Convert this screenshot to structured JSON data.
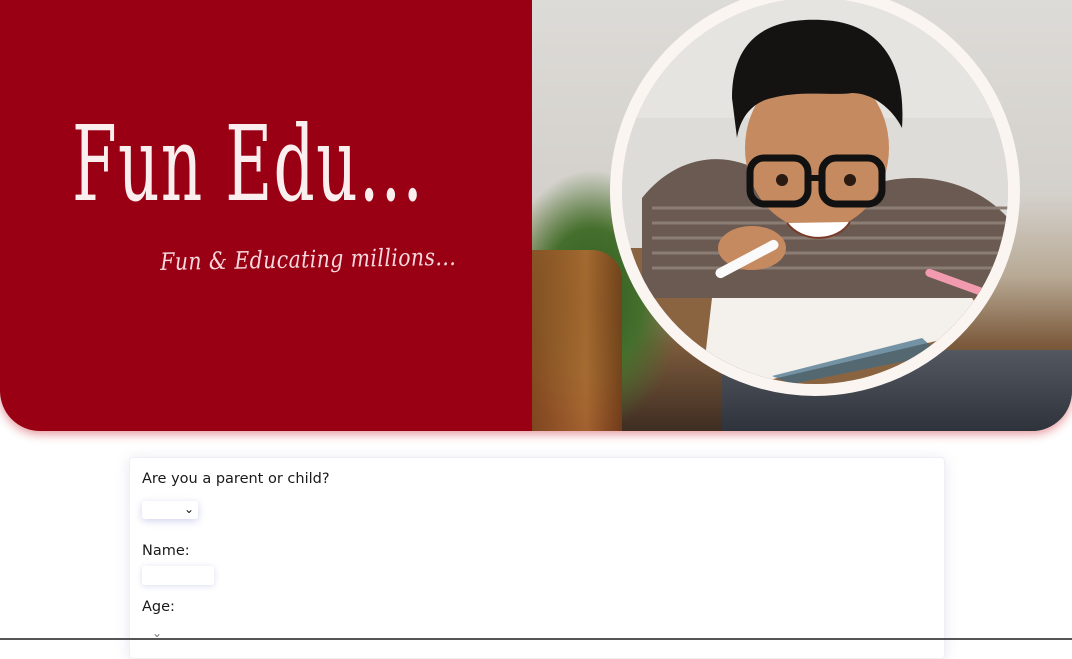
{
  "hero": {
    "brand_title": "Fun Edu...",
    "tagline": "Fun & Educating millions...",
    "photo_description": "smiling boy with glasses drawing"
  },
  "form": {
    "role_label": "Are you a parent or child?",
    "role_value": "",
    "name_label": "Name:",
    "name_value": "",
    "age_label": "Age:"
  },
  "colors": {
    "brand_red": "#9a0014",
    "title_text": "#fbeeee",
    "circle_frame": "#fbf5f2"
  },
  "icons": [
    "chevron-down-icon"
  ]
}
